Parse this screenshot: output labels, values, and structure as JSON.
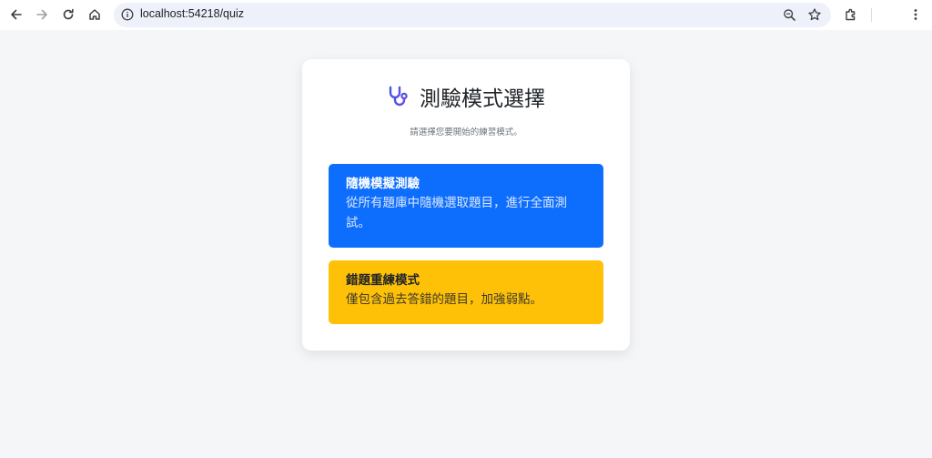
{
  "browser": {
    "url": "localhost:54218/quiz",
    "icons": {
      "back": "arrow-left-icon",
      "forward": "arrow-right-icon",
      "reload": "reload-icon",
      "home": "home-icon",
      "site_info": "info-icon",
      "zoom": "zoom-icon",
      "bookmark": "star-icon",
      "extensions": "puzzle-icon",
      "menu": "kebab-menu-icon"
    }
  },
  "page": {
    "icon": "stethoscope-icon",
    "title": "測驗模式選擇",
    "subtitle": "請選擇您要開始的練習模式。",
    "options": [
      {
        "title": "隨機模擬測驗",
        "description": "從所有題庫中隨機選取題目，進行全面測試。",
        "color": "#0d6efd"
      },
      {
        "title": "錯題重練模式",
        "description": "僅包含過去答錯的題目，加強弱點。",
        "color": "#ffc107"
      }
    ]
  },
  "colors": {
    "background": "#f5f6f8",
    "card": "#ffffff",
    "primary": "#0d6efd",
    "warning": "#ffc107",
    "icon_gradient_start": "#3b5bdb",
    "icon_gradient_end": "#7048e8"
  }
}
